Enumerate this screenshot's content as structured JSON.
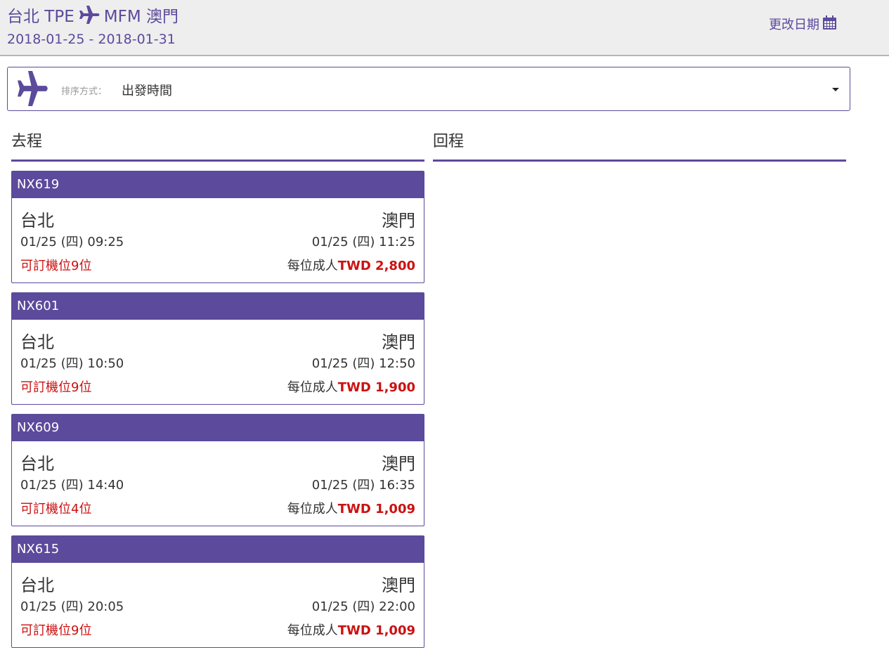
{
  "header": {
    "origin": "台北 TPE",
    "destination": "MFM 澳門",
    "date_range": "2018-01-25 - 2018-01-31",
    "change_date_label": "更改日期"
  },
  "sort": {
    "label": "排序方式：",
    "value": "出發時間"
  },
  "columns": {
    "outbound": "去程",
    "return": "回程"
  },
  "colors": {
    "accent": "#5c4a9c",
    "price": "#cc1111"
  },
  "flights": [
    {
      "code": "NX619",
      "from_city": "台北",
      "to_city": "澳門",
      "depart": "01/25 (四) 09:25",
      "arrive": "01/25 (四) 11:25",
      "seats": "可訂機位9位",
      "price_prefix": "每位成人",
      "price": "TWD 2,800"
    },
    {
      "code": "NX601",
      "from_city": "台北",
      "to_city": "澳門",
      "depart": "01/25 (四) 10:50",
      "arrive": "01/25 (四) 12:50",
      "seats": "可訂機位9位",
      "price_prefix": "每位成人",
      "price": "TWD 1,900"
    },
    {
      "code": "NX609",
      "from_city": "台北",
      "to_city": "澳門",
      "depart": "01/25 (四) 14:40",
      "arrive": "01/25 (四) 16:35",
      "seats": "可訂機位4位",
      "price_prefix": "每位成人",
      "price": "TWD 1,009"
    },
    {
      "code": "NX615",
      "from_city": "台北",
      "to_city": "澳門",
      "depart": "01/25 (四) 20:05",
      "arrive": "01/25 (四) 22:00",
      "seats": "可訂機位9位",
      "price_prefix": "每位成人",
      "price": "TWD 1,009"
    }
  ]
}
